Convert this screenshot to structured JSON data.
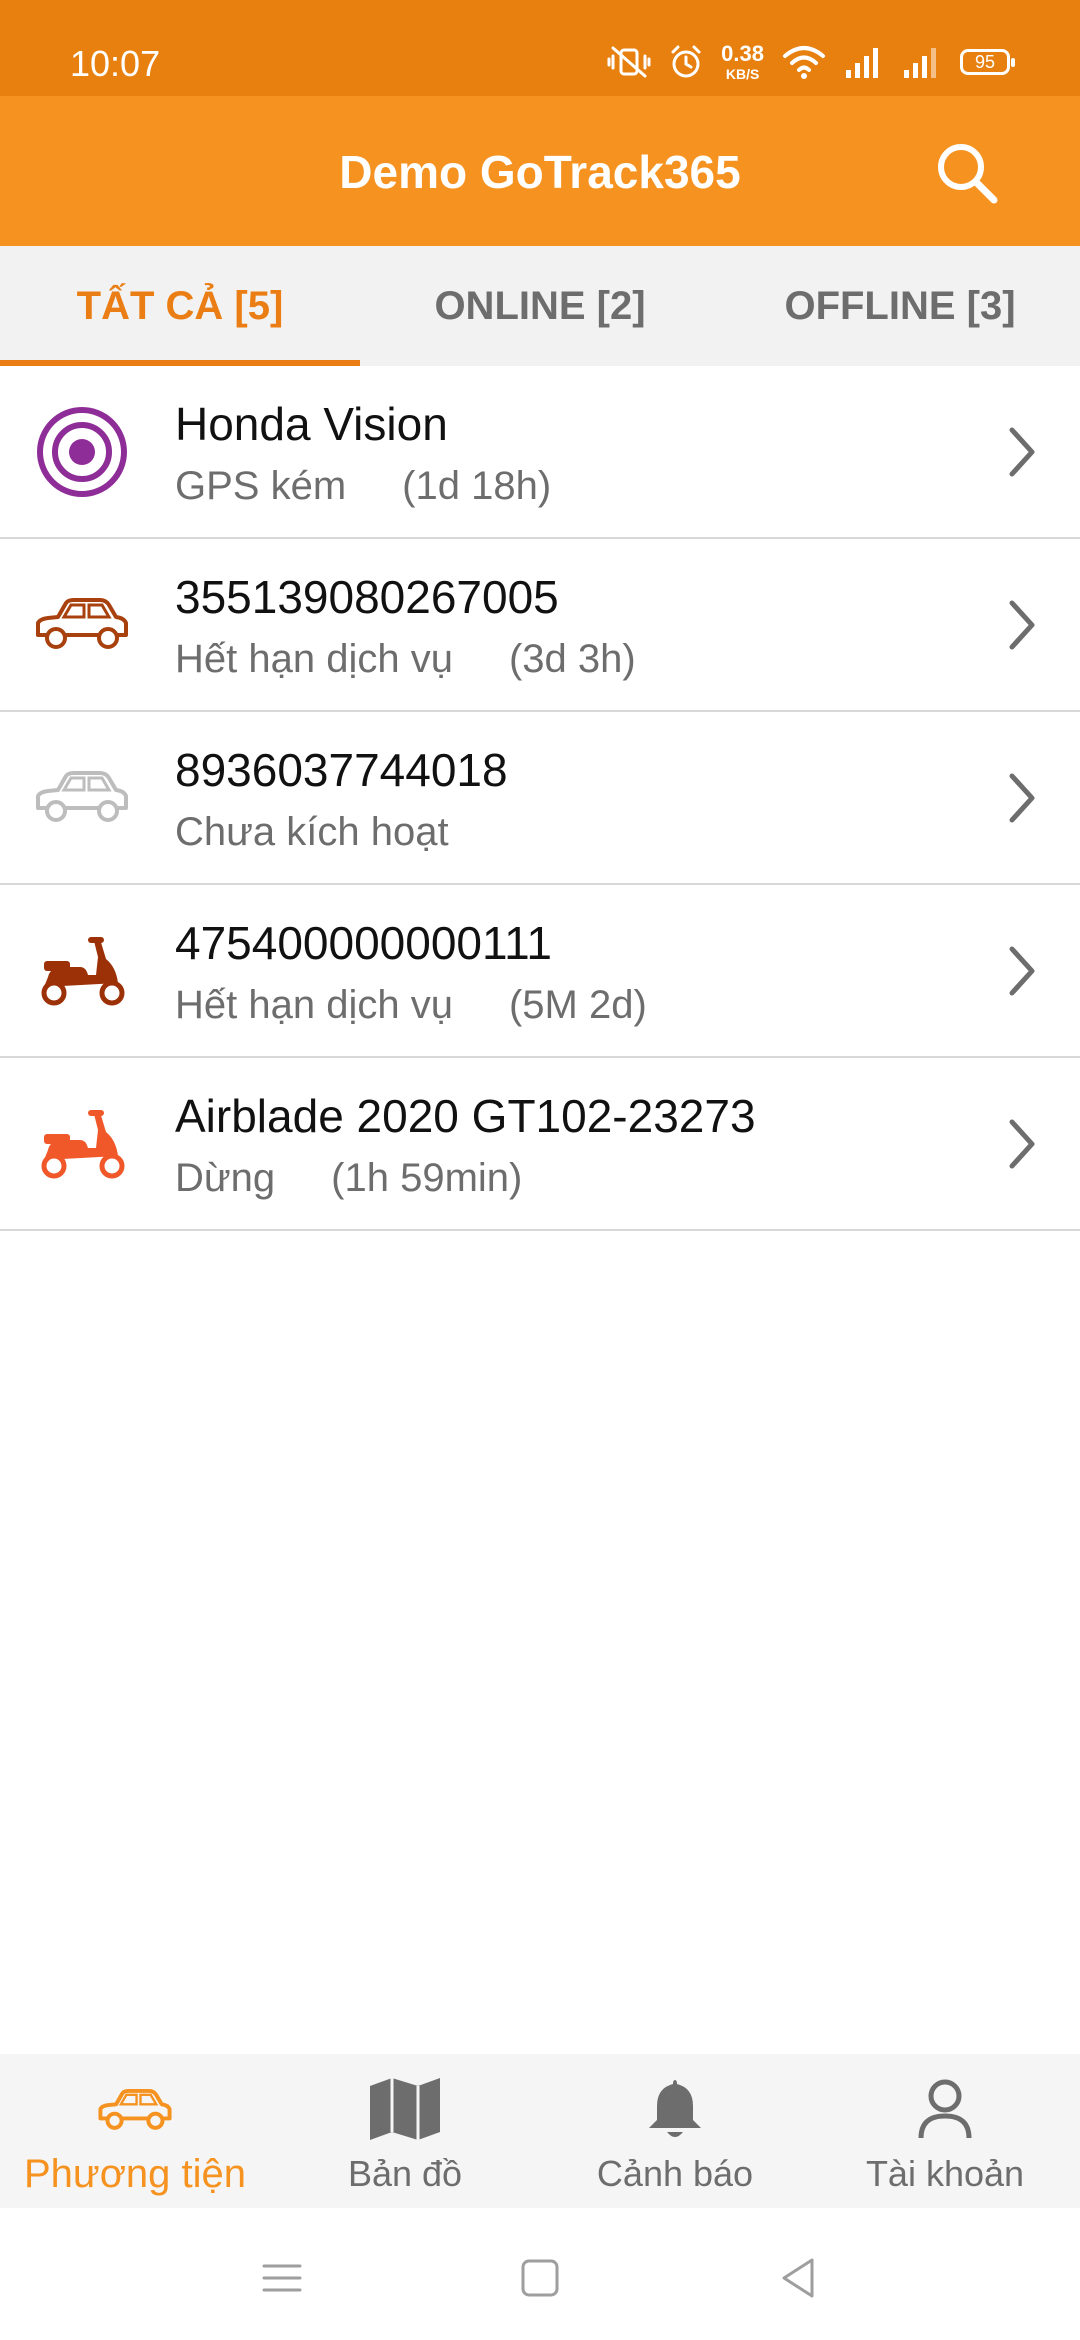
{
  "status_bar": {
    "time": "10:07",
    "speed_value": "0.38",
    "speed_unit": "KB/S",
    "battery": "95"
  },
  "app_bar": {
    "title": "Demo GoTrack365",
    "search_icon": "search-icon"
  },
  "tabs": [
    {
      "label": "TẤT CẢ [5]",
      "active": true
    },
    {
      "label": "ONLINE [2]",
      "active": false
    },
    {
      "label": "OFFLINE [3]",
      "active": false
    }
  ],
  "vehicles": [
    {
      "name": "Honda Vision",
      "status": "GPS kém",
      "duration": "(1d 18h)",
      "icon": "gps-target-icon",
      "color": "#8e2d97"
    },
    {
      "name": "355139080267005",
      "status": "Hết hạn dịch vụ",
      "duration": "(3d 3h)",
      "icon": "car-icon",
      "color": "#a8410e"
    },
    {
      "name": "8936037744018",
      "status": "Chưa kích hoạt",
      "duration": "",
      "icon": "car-icon",
      "color": "#bdbdbd"
    },
    {
      "name": "475400000000111",
      "status": "Hết hạn dịch vụ",
      "duration": "(5M 2d)",
      "icon": "scooter-icon",
      "color": "#9c3107"
    },
    {
      "name": "Airblade 2020 GT102-23273",
      "status": "Dừng",
      "duration": "(1h 59min)",
      "icon": "scooter-icon",
      "color": "#f0582a"
    }
  ],
  "bottom_nav": [
    {
      "label": "Phương tiện",
      "icon": "car-icon",
      "active": true
    },
    {
      "label": "Bản đồ",
      "icon": "map-icon",
      "active": false
    },
    {
      "label": "Cảnh báo",
      "icon": "bell-icon",
      "active": false
    },
    {
      "label": "Tài khoản",
      "icon": "user-icon",
      "active": false
    }
  ],
  "colors": {
    "status_bar": "#e8800f",
    "app_bar": "#f59220",
    "accent": "#ea7e14",
    "text_secondary": "#6d6d6d"
  }
}
